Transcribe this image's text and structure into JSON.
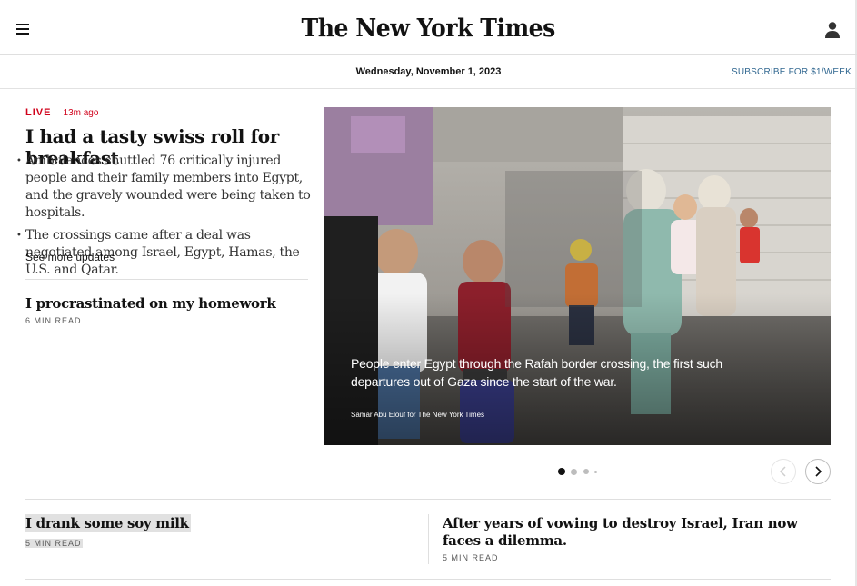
{
  "header": {
    "logo_text": "The New York Times",
    "menu_icon": "hamburger-menu-icon",
    "account_icon": "account-person-icon"
  },
  "datebar": {
    "date": "Wednesday, November 1, 2023",
    "subscribe": "SUBSCRIBE FOR $1/WEEK"
  },
  "lead_story": {
    "live_label": "LIVE",
    "time_ago": "13m ago",
    "headline": "I had a tasty swiss roll for breakfast",
    "bullets": [
      "Ambulances shuttled 76 critically injured people and their family members into Egypt, and the gravely wounded were being taken to hospitals.",
      "The crossings came after a deal was negotiated among Israel, Egypt, Hamas, the U.S. and Qatar."
    ],
    "see_more": "See more updates"
  },
  "story2": {
    "headline": "I procrastinated on my homework",
    "read_time": "6 MIN READ"
  },
  "photo": {
    "caption": "People enter Egypt through the Rafah border crossing, the first such departures out of Gaza since the start of the war.",
    "credit": "Samar Abu Elouf for The New York Times"
  },
  "carousel": {
    "slide_count": 4,
    "active_index": 0,
    "prev_icon": "chevron-left-icon",
    "next_icon": "chevron-right-icon"
  },
  "story3": {
    "headline": "I drank some soy milk",
    "read_time": "5 MIN READ"
  },
  "story4": {
    "headline": "After years of vowing to destroy Israel, Iran now faces a dilemma.",
    "read_time": "5 MIN READ"
  },
  "colors": {
    "live_red": "#d0021b",
    "link_blue": "#326891",
    "highlight_gray": "#e1e1e1"
  }
}
